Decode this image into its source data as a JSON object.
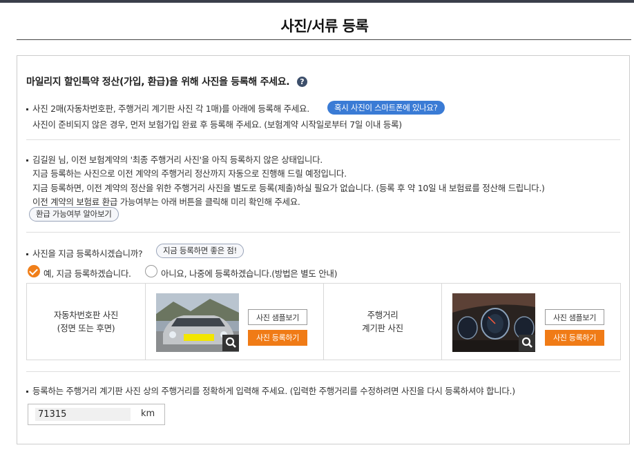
{
  "page_title": "사진/서류 등록",
  "heading": "마일리지 할인특약 정산(가입, 환급)을 위해 사진을 등록해 주세요.",
  "help_icon_glyph": "?",
  "section1": {
    "line1": "사진 2매(자동차번호판, 주행거리 계기판 사진 각 1매)를 아래에 등록해 주세요.",
    "smartphone_button": "혹시 사진이 스마트폰에 있나요?",
    "line2": "사진이 준비되지 않은 경우, 먼저 보험가입 완료 후 등록해 주세요. (보험계약 시작일로부터 7일 이내 등록)"
  },
  "section2": {
    "line1": "김길원 님, 이전 보험계약의 '최종 주행거리 사진'을 아직 등록하지 않은 상태입니다.",
    "line2": "지금 등록하는 사진으로 이전 계약의 주행거리 정산까지 자동으로 진행해 드릴 예정입니다.",
    "line3": "지금 등록하면, 이전 계약의 정산을 위한 주행거리 사진을 별도로 등록(제출)하실 필요가 없습니다. (등록 후 약 10일 내 보험료를 정산해 드립니다.)",
    "line4": "이전 계약의 보험료 환급 가능여부는 아래 버튼을 클릭해 미리 확인해 주세요.",
    "refund_button": "환급 가능여부 알아보기"
  },
  "section3": {
    "question": "사진을 지금 등록하시겠습니까?",
    "benefit_button": "지금 등록하면 좋은 점!",
    "option_yes": "예, 지금 등록하겠습니다.",
    "option_no": "아니요, 나중에 등록하겠습니다.(방법은 별도 안내)",
    "selected": "yes"
  },
  "photos": {
    "plate_label_1": "자동차번호판 사진",
    "plate_label_2": "(정면 또는 후면)",
    "odometer_label_1": "주행거리",
    "odometer_label_2": "계기판 사진",
    "sample_button": "사진 샘플보기",
    "register_button": "사진 등록하기"
  },
  "mileage": {
    "instruction": "등록하는 주행거리 계기판 사진 상의 주행거리를 정확하게 입력해 주세요. (입력한 주행거리를 수정하려면 사진을 다시 등록하셔야 합니다.)",
    "value": "71315",
    "unit": "km"
  },
  "colors": {
    "accent_orange": "#f07b16",
    "accent_blue": "#3a7bd5",
    "topbar": "#3a3f4a"
  }
}
